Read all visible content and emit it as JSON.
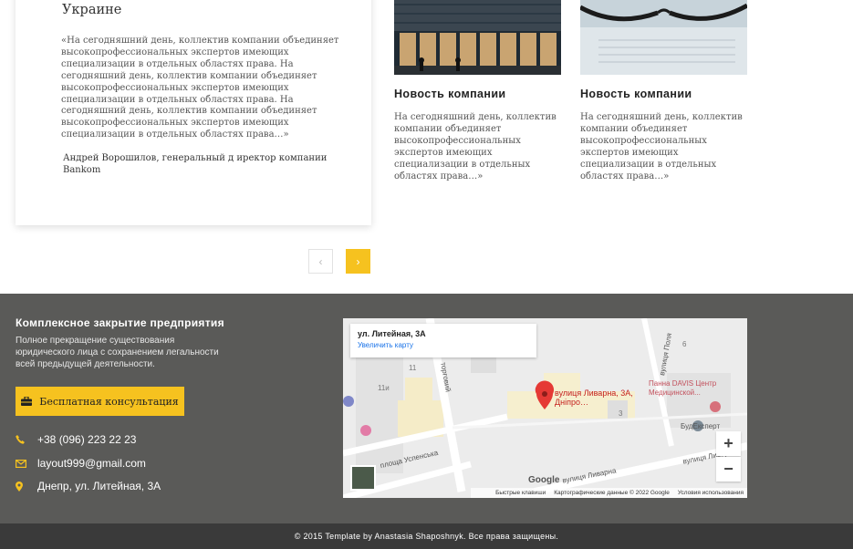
{
  "testimonial": {
    "title": "Банкротство и ликвидация предприятия в Украине",
    "quote": "«На сегодняшний день, коллектив компании объединяет высокопрофессиональных экспертов имеющих специализации в отдельных областях права. На сегодняшний день, коллектив компании объединяет высокопрофессиональных экспертов имеющих специализации в отдельных областях права. На сегодняшний день, коллектив компании объединяет высокопрофессиональных экспертов имеющих специализации в отдельных областях права…»",
    "author": "Андрей Ворошилов, генеральный д иректор компании Bankom"
  },
  "news": [
    {
      "title": "Новость компании",
      "text": "На сегодняшний день, коллектив компании объединяет высокопрофессиональных экспертов имеющих специализации в отдельных областях права…»",
      "image_icon": "office-building-photo"
    },
    {
      "title": "Новость компании",
      "text": "На сегодняшний день, коллектив компании объединяет высокопрофессиональных экспертов имеющих специализации в отдельных областях права…»",
      "image_icon": "glasses-on-paper-photo"
    }
  ],
  "pagination": {
    "prev": "‹",
    "next": "›"
  },
  "footer": {
    "title": "Комплексное закрытие предприятия",
    "description": "Полное прекращение существования юридического лица с сохранением легальности всей предыдущей деятельности.",
    "button_label": "Бесплатная консультация",
    "phone": "+38 (096) 223 22 23",
    "email": "layout999@gmail.com",
    "address": "Днепр, ул. Литейная, 3А"
  },
  "map": {
    "card_address": "ул. Литейная, 3А",
    "card_link": "Увеличить карту",
    "pin_label": "вулиця Ливарна, 3А, Дніпро…",
    "poi_1": "Панна DAVIS Центр Медицинской...",
    "poi_2": "БудЕксперт",
    "street_1": "площа Успенська",
    "street_2": "вулиця Ливарна",
    "street_3": "вулиця Ливарна",
    "street_4": "вулиця Поля",
    "street_5": "торговий",
    "label_11": "11",
    "label_11i": "11и",
    "label_3": "3",
    "label_6": "6",
    "zoom_in": "+",
    "zoom_out": "−",
    "footer_keys": "Быстрые клавиши",
    "footer_data": "Картографические данные © 2022 Google",
    "footer_terms": "Условия использования",
    "google": "Google"
  },
  "copyright": "© 2015 Template by Anastasia Shaposhnyk. Все права защищены.",
  "colors": {
    "accent": "#f6c21f",
    "footer_bg": "#5a5a58",
    "bottom_bg": "#3a3a3a"
  }
}
